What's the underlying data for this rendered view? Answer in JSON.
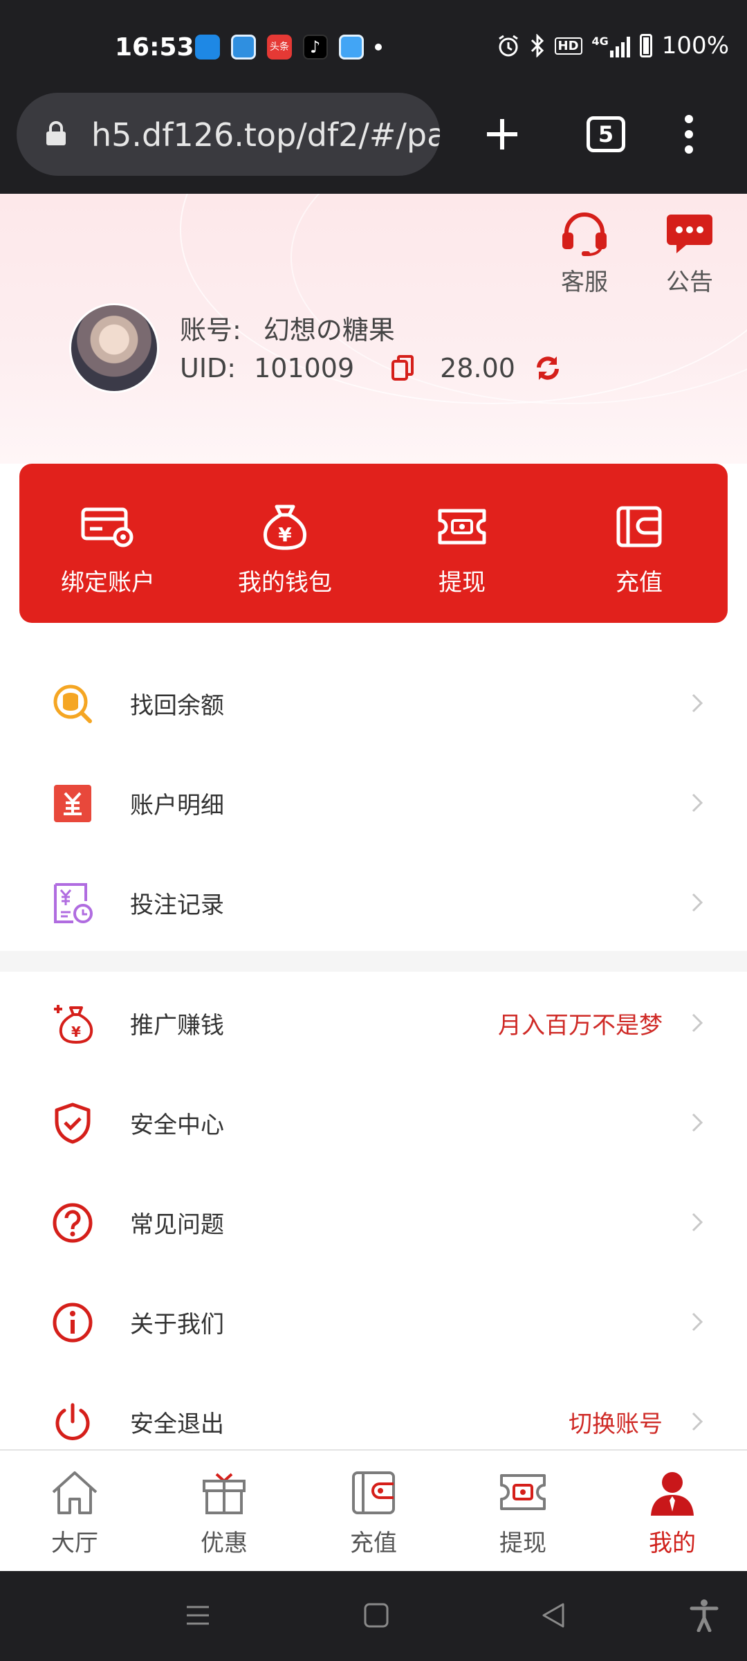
{
  "status_bar": {
    "time": "16:53",
    "notif_icons": [
      "app-icon",
      "qq-icon",
      "toutiao-icon",
      "tiktok-icon",
      "app-icon"
    ],
    "toutiao_text": "头条",
    "hd_badge": "HD",
    "network": "4G",
    "battery": "100%"
  },
  "browser": {
    "url": "h5.df126.top/df2/#/pa",
    "tab_count": "5"
  },
  "header": {
    "customer_service_label": "客服",
    "announcement_label": "公告",
    "account_label": "账号:",
    "account_name": "幻想の糖果",
    "uid_label": "UID:",
    "uid_value": "101009",
    "balance": "28.00"
  },
  "actions": [
    {
      "label": "绑定账户",
      "icon": "bind-card-icon"
    },
    {
      "label": "我的钱包",
      "icon": "money-bag-icon"
    },
    {
      "label": "提现",
      "icon": "withdraw-icon"
    },
    {
      "label": "充值",
      "icon": "recharge-wallet-icon"
    }
  ],
  "menu": [
    {
      "label": "找回余额",
      "extra": "",
      "icon": "coin-search-icon"
    },
    {
      "label": "账户明细",
      "extra": "",
      "icon": "yen-ledger-icon"
    },
    {
      "label": "投注记录",
      "extra": "",
      "icon": "bet-record-icon"
    },
    {
      "label": "推广赚钱",
      "extra": "月入百万不是梦",
      "icon": "promote-money-icon"
    },
    {
      "label": "安全中心",
      "extra": "",
      "icon": "shield-icon"
    },
    {
      "label": "常见问题",
      "extra": "",
      "icon": "question-icon"
    },
    {
      "label": "关于我们",
      "extra": "",
      "icon": "info-icon"
    },
    {
      "label": "安全退出",
      "extra": "切换账号",
      "icon": "power-icon"
    }
  ],
  "bottom_nav": [
    {
      "label": "大厅",
      "icon": "home-icon",
      "active": false
    },
    {
      "label": "优惠",
      "icon": "gift-icon",
      "active": false
    },
    {
      "label": "充值",
      "icon": "recharge-icon",
      "active": false
    },
    {
      "label": "提现",
      "icon": "withdraw-icon",
      "active": false
    },
    {
      "label": "我的",
      "icon": "user-icon",
      "active": true
    }
  ],
  "colors": {
    "brand_red": "#e1211c",
    "accent_text_red": "#cf2a26",
    "header_bg": "#fde8ea",
    "system_bar": "#1f1f22"
  }
}
